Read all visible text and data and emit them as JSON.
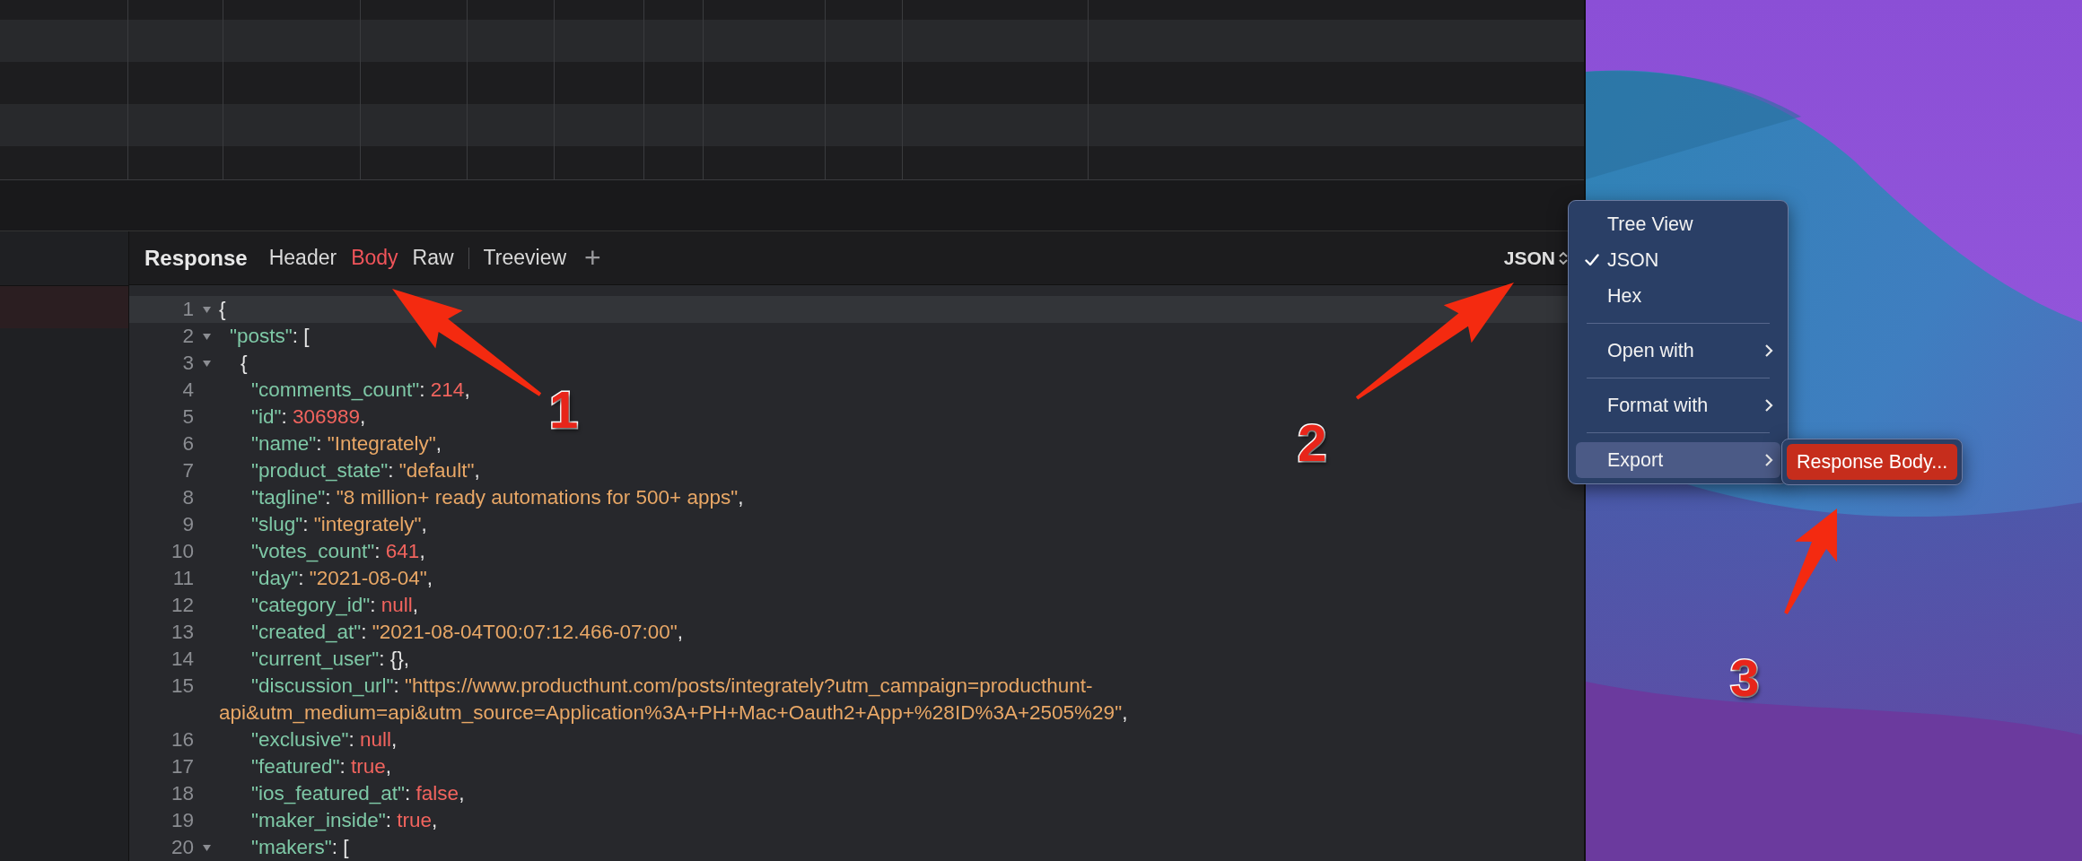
{
  "response_bar": {
    "title": "Response",
    "tabs": [
      {
        "label": "Header",
        "selected": false
      },
      {
        "label": "Body",
        "selected": true
      },
      {
        "label": "Raw",
        "selected": false
      },
      {
        "label": "Treeview",
        "selected": false
      }
    ],
    "add_tab": "+",
    "format": "JSON"
  },
  "code_lines": [
    {
      "number": "1",
      "fold": true,
      "tokens": [
        {
          "kind": "punct",
          "text": "{"
        }
      ]
    },
    {
      "number": "2",
      "fold": true,
      "tokens": [
        {
          "kind": "key",
          "text": "\"posts\""
        },
        {
          "kind": "punct",
          "text": ": ["
        }
      ]
    },
    {
      "number": "3",
      "fold": true,
      "tokens": [
        {
          "kind": "punct",
          "text": "{"
        }
      ]
    },
    {
      "number": "4",
      "fold": false,
      "tokens": [
        {
          "kind": "key",
          "text": "\"comments_count\""
        },
        {
          "kind": "punct",
          "text": ": "
        },
        {
          "kind": "number",
          "text": "214"
        },
        {
          "kind": "punct",
          "text": ","
        }
      ]
    },
    {
      "number": "5",
      "fold": false,
      "tokens": [
        {
          "kind": "key",
          "text": "\"id\""
        },
        {
          "kind": "punct",
          "text": ": "
        },
        {
          "kind": "number",
          "text": "306989"
        },
        {
          "kind": "punct",
          "text": ","
        }
      ]
    },
    {
      "number": "6",
      "fold": false,
      "tokens": [
        {
          "kind": "key",
          "text": "\"name\""
        },
        {
          "kind": "punct",
          "text": ": "
        },
        {
          "kind": "string",
          "text": "\"Integrately\""
        },
        {
          "kind": "punct",
          "text": ","
        }
      ]
    },
    {
      "number": "7",
      "fold": false,
      "tokens": [
        {
          "kind": "key",
          "text": "\"product_state\""
        },
        {
          "kind": "punct",
          "text": ": "
        },
        {
          "kind": "string",
          "text": "\"default\""
        },
        {
          "kind": "punct",
          "text": ","
        }
      ]
    },
    {
      "number": "8",
      "fold": false,
      "tokens": [
        {
          "kind": "key",
          "text": "\"tagline\""
        },
        {
          "kind": "punct",
          "text": ": "
        },
        {
          "kind": "string",
          "text": "\"8 million+ ready automations for 500+ apps\""
        },
        {
          "kind": "punct",
          "text": ","
        }
      ]
    },
    {
      "number": "9",
      "fold": false,
      "tokens": [
        {
          "kind": "key",
          "text": "\"slug\""
        },
        {
          "kind": "punct",
          "text": ": "
        },
        {
          "kind": "string",
          "text": "\"integrately\""
        },
        {
          "kind": "punct",
          "text": ","
        }
      ]
    },
    {
      "number": "10",
      "fold": false,
      "tokens": [
        {
          "kind": "key",
          "text": "\"votes_count\""
        },
        {
          "kind": "punct",
          "text": ": "
        },
        {
          "kind": "number",
          "text": "641"
        },
        {
          "kind": "punct",
          "text": ","
        }
      ]
    },
    {
      "number": "11",
      "fold": false,
      "tokens": [
        {
          "kind": "key",
          "text": "\"day\""
        },
        {
          "kind": "punct",
          "text": ": "
        },
        {
          "kind": "string",
          "text": "\"2021-08-04\""
        },
        {
          "kind": "punct",
          "text": ","
        }
      ]
    },
    {
      "number": "12",
      "fold": false,
      "tokens": [
        {
          "kind": "key",
          "text": "\"category_id\""
        },
        {
          "kind": "punct",
          "text": ": "
        },
        {
          "kind": "literal",
          "text": "null"
        },
        {
          "kind": "punct",
          "text": ","
        }
      ]
    },
    {
      "number": "13",
      "fold": false,
      "tokens": [
        {
          "kind": "key",
          "text": "\"created_at\""
        },
        {
          "kind": "punct",
          "text": ": "
        },
        {
          "kind": "string",
          "text": "\"2021-08-04T00:07:12.466-07:00\""
        },
        {
          "kind": "punct",
          "text": ","
        }
      ]
    },
    {
      "number": "14",
      "fold": false,
      "tokens": [
        {
          "kind": "key",
          "text": "\"current_user\""
        },
        {
          "kind": "punct",
          "text": ": {},"
        }
      ]
    },
    {
      "number": "15",
      "fold": false,
      "tokens": [
        {
          "kind": "key",
          "text": "\"discussion_url\""
        },
        {
          "kind": "punct",
          "text": ": "
        },
        {
          "kind": "string",
          "text": "\"https://www.producthunt.com/posts/integrately?utm_campaign=producthunt-"
        }
      ]
    },
    {
      "wrapped": true,
      "tokens": [
        {
          "kind": "string",
          "text": "api&utm_medium=api&utm_source=Application%3A+PH+Mac+Oauth2+App+%28ID%3A+2505%29\""
        },
        {
          "kind": "punct",
          "text": ","
        }
      ]
    },
    {
      "number": "16",
      "fold": false,
      "tokens": [
        {
          "kind": "key",
          "text": "\"exclusive\""
        },
        {
          "kind": "punct",
          "text": ": "
        },
        {
          "kind": "literal",
          "text": "null"
        },
        {
          "kind": "punct",
          "text": ","
        }
      ]
    },
    {
      "number": "17",
      "fold": false,
      "tokens": [
        {
          "kind": "key",
          "text": "\"featured\""
        },
        {
          "kind": "punct",
          "text": ": "
        },
        {
          "kind": "literal",
          "text": "true"
        },
        {
          "kind": "punct",
          "text": ","
        }
      ]
    },
    {
      "number": "18",
      "fold": false,
      "tokens": [
        {
          "kind": "key",
          "text": "\"ios_featured_at\""
        },
        {
          "kind": "punct",
          "text": ": "
        },
        {
          "kind": "literal",
          "text": "false"
        },
        {
          "kind": "punct",
          "text": ","
        }
      ]
    },
    {
      "number": "19",
      "fold": false,
      "tokens": [
        {
          "kind": "key",
          "text": "\"maker_inside\""
        },
        {
          "kind": "punct",
          "text": ": "
        },
        {
          "kind": "literal",
          "text": "true"
        },
        {
          "kind": "punct",
          "text": ","
        }
      ]
    },
    {
      "number": "20",
      "fold": true,
      "tokens": [
        {
          "kind": "key",
          "text": "\"makers\""
        },
        {
          "kind": "punct",
          "text": ": ["
        }
      ]
    }
  ],
  "menu": {
    "items": [
      {
        "kind": "item",
        "label": "Tree View",
        "checked": false,
        "selected": false
      },
      {
        "kind": "item",
        "label": "JSON",
        "checked": true,
        "selected": false
      },
      {
        "kind": "item",
        "label": "Hex",
        "checked": false,
        "selected": false
      },
      {
        "kind": "separator"
      },
      {
        "kind": "submenu",
        "label": "Open with",
        "checked": false,
        "selected": false
      },
      {
        "kind": "separator"
      },
      {
        "kind": "submenu",
        "label": "Format with",
        "checked": false,
        "selected": false
      },
      {
        "kind": "separator"
      },
      {
        "kind": "submenu",
        "label": "Export",
        "checked": false,
        "selected": true
      }
    ],
    "submenu": {
      "items": [
        {
          "label": "Response Body...",
          "selected": true
        }
      ]
    }
  },
  "annotations": [
    {
      "label": "1"
    },
    {
      "label": "2"
    },
    {
      "label": "3"
    }
  ]
}
